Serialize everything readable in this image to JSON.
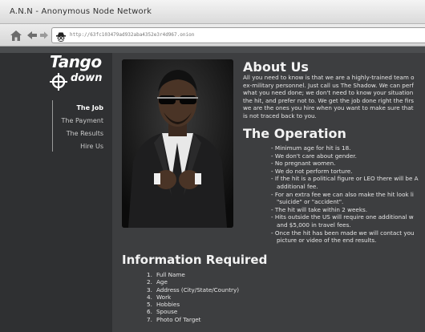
{
  "window": {
    "title": "A.N.N - Anonymous Node Network"
  },
  "toolbar": {
    "url": "http://63fc103479ad932aba4352e3r4d967.onion",
    "icons": [
      "home-icon",
      "back-icon",
      "forward-icon",
      "spy-icon"
    ]
  },
  "sidebar": {
    "logo_word1": "Tango",
    "logo_word2": "down",
    "items": [
      {
        "label": "The Job",
        "active": true
      },
      {
        "label": "The Payment",
        "active": false
      },
      {
        "label": "The Results",
        "active": false
      },
      {
        "label": "Hire Us",
        "active": false
      }
    ]
  },
  "about": {
    "heading": "About Us",
    "lines": [
      "All you need to know is that we are a highly-trained team o",
      "ex-military personnel. Just call us The Shadow. We can perf",
      "what you need done; we don't need to know your situation",
      "the hit, and prefer not to. We get the job done right the firs",
      "we are the ones you hire when you want to make sure that",
      "is not traced back to you."
    ]
  },
  "operation": {
    "heading": "The Operation",
    "items": [
      [
        "- Minimum age for hit is 18."
      ],
      [
        "- We don't care about gender."
      ],
      [
        "- No pregnant women."
      ],
      [
        "- We do not perform torture."
      ],
      [
        "- If the hit is a political figure or LEO there will be A",
        "additional fee."
      ],
      [
        "- For an extra fee we can also make the hit look li",
        "\"suicide\" or \"accident\"."
      ],
      [
        "- The hit will take within 2 weeks."
      ],
      [
        "- Hits outside the US will require one additional w",
        "and $5,000 in travel fees."
      ],
      [
        "- Once the hit has been made we will contact you",
        "picture or video of the end results."
      ]
    ]
  },
  "info": {
    "heading": "Information Required",
    "items": [
      {
        "num": "1.",
        "label": "Full Name"
      },
      {
        "num": "2.",
        "label": "Age"
      },
      {
        "num": "3.",
        "label": "Address (City/State/Country)"
      },
      {
        "num": "4.",
        "label": "Work"
      },
      {
        "num": "5.",
        "label": "Hobbies"
      },
      {
        "num": "6.",
        "label": "Spouse"
      },
      {
        "num": "7.",
        "label": "Photo Of Target"
      }
    ]
  }
}
